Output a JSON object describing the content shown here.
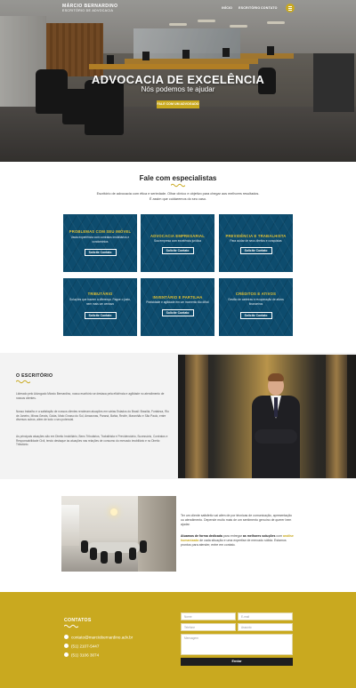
{
  "header": {
    "logo_line1": "MÁRCIO BERNARDINO",
    "logo_line2": "ESCRITÓRIO DE ADVOCACIA",
    "nav": [
      "INÍCIO",
      "ESCRITÓRIO",
      "CONTATO"
    ],
    "accent_color": "#c9a91f"
  },
  "hero": {
    "title": "ADVOCACIA DE EXCELÊNCIA",
    "subtitle": "Nós podemos te ajudar",
    "cta": "FALE COM UM ADVOGADO"
  },
  "specialists": {
    "title": "Fale com especialistas",
    "text_line1": "Escritório de advocacia com ética e seriedade. Olhar clínico e objetivo para chegar aos melhores resultados.",
    "text_line2": "É assim que cuidaremos do seu caso.",
    "cards": [
      {
        "title": "PROBLEMAS COM SEU IMÓVEL",
        "desc": "Vasta experiência com contratos imobiliários e condomínios",
        "button": "Solicite Contato"
      },
      {
        "title": "ADVOCACIA EMPRESARIAL",
        "desc": "Sua empresa com excelência jurídica",
        "button": "Solicite Contato"
      },
      {
        "title": "PREVIDÊNCIA E TRABALHISTA",
        "desc": "Para cuidar de seus direitos e conquistas",
        "button": "Solicite Contato"
      },
      {
        "title": "TRIBUTÁRIO",
        "desc": "Soluções que trazem a diferença. Pague o justo, nem mais um centavo",
        "button": "Solicite Contato"
      },
      {
        "title": "INVENTÁRIO E PARTILHA",
        "desc": "Praticidade e agilidade em um momento tão difícil",
        "button": "Solicite Contato"
      },
      {
        "title": "CRÉDITOS E ATIVOS",
        "desc": "Gestão de carteiras e recuperação de ativos financeiros",
        "button": "Solicite Contato"
      }
    ]
  },
  "escritorio": {
    "title": "O ESCRITÓRIO",
    "p1": "Liderado pelo Advogado Márcio Bernardino, nosso escritório se destaca pela eficiência e agilidade no atendimento de nossos clientes.",
    "p2": "Nosso trabalho e a satisfação de nossos clientes renderam atuações em várias Estados do Brasil: Brasília, Fortaleza, Rio de Janeiro, Minas Gerais, Goiás, Mato Grosso do Sul, Amazonas, Paraná, Bahia, Recife, Maranhão e São Paulo, entre diversos outros, além de todo o seu potencial.",
    "p3": "As principais atuações são em Direito Imobiliário, Bens Tributários, Trabalhista e Previdenciário, Sucessório, Contratos e Responsabilidade Civil, tendo destaque às atuações nas relações de consumo do mercado imobiliário e no Direito Tributário."
  },
  "meeting": {
    "text1": "Ter um cliente satisfeito vai além de por técnicas de comunicação, apresentação ou atendimento. Depende muito mais de um sentimento genuíno de querer bem ajudar.",
    "text2_bold": "Atuamos de forma dedicada",
    "text2_a": " para entregar ",
    "text2_hl": "as melhores soluções",
    "text2_b": " com ",
    "text2_bold2": "análise humanizada",
    "text2_c": " de cada situação e uma expertise de mercado sólida. Estamos prontos para atender, entre em contato."
  },
  "contact": {
    "title": "CONTATOS",
    "email": "contato@marciobernardino.adv.br",
    "phone1": "(51) 2107-5447",
    "phone2": "(51) 3106 3074",
    "name_placeholder": "Nome",
    "email_placeholder": "E-mail",
    "phone_placeholder": "Telefone",
    "subject_placeholder": "Assunto",
    "message_placeholder": "Mensagem",
    "send": "Enviar"
  }
}
